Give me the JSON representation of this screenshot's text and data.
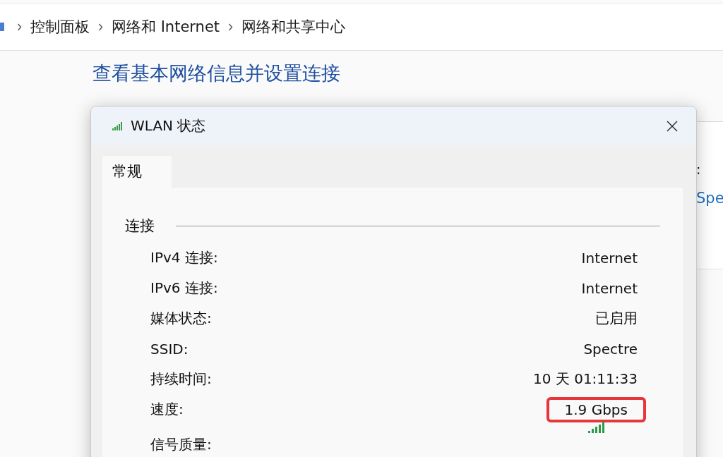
{
  "breadcrumb": [
    "控制面板",
    "网络和 Internet",
    "网络和共享中心"
  ],
  "heading": "查看基本网络信息并设置连接",
  "background_panel": {
    "label": ":",
    "link": "Spe"
  },
  "dialog": {
    "title": "WLAN 状态",
    "tabs": [
      {
        "label": "常规",
        "selected": true
      }
    ],
    "group": {
      "title": "连接",
      "rows": [
        {
          "kind": "text",
          "label": "IPv4 连接:",
          "value": "Internet",
          "highlighted": false
        },
        {
          "kind": "text",
          "label": "IPv6 连接:",
          "value": "Internet",
          "highlighted": false
        },
        {
          "kind": "text",
          "label": "媒体状态:",
          "value": "已启用",
          "highlighted": false
        },
        {
          "kind": "text",
          "label": "SSID:",
          "value": "Spectre",
          "highlighted": false
        },
        {
          "kind": "text",
          "label": "持续时间:",
          "value": "10 天 01:11:33",
          "highlighted": false
        },
        {
          "kind": "text",
          "label": "速度:",
          "value": "1.9 Gbps",
          "highlighted": true
        },
        {
          "kind": "signal",
          "label": "信号质量:"
        }
      ]
    }
  }
}
